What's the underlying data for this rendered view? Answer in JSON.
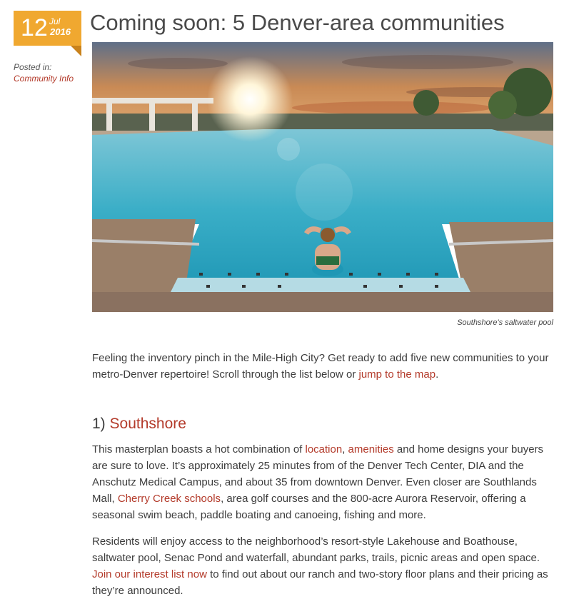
{
  "post": {
    "date": {
      "day": "12",
      "month": "Jul",
      "year": "2016"
    },
    "posted_in_label": "Posted in:",
    "category": "Community Info",
    "title": "Coming soon: 5 Denver-area communities"
  },
  "hero": {
    "caption": "Southshore's saltwater pool"
  },
  "intro": {
    "text_before": "Feeling the inventory pinch in the Mile-High City? Get ready to add five new communities to your metro-Denver repertoire! Scroll through the list below or ",
    "link_text": "jump to the map",
    "text_after": "."
  },
  "section1": {
    "number": "1) ",
    "heading_link": "Southshore",
    "p1": {
      "t1": "This masterplan boasts a hot combination of ",
      "l1": "location",
      "t2": ", ",
      "l2": "amenities",
      "t3": " and home designs your buyers are sure to love. It’s approximately 25 minutes from of the Denver Tech Center, DIA and the Anschutz Medical Campus, and about 35 from downtown Denver. Even closer are Southlands Mall, ",
      "l3": "Cherry Creek schools",
      "t4": ", area golf courses and the 800-acre Aurora Reservoir, offering a seasonal swim beach, paddle boating and canoeing, fishing and more."
    },
    "p2": {
      "t1": "Residents will enjoy access to the neighborhood’s resort-style Lakehouse and Boathouse, saltwater pool, Senac Pond and waterfall, abundant parks, trails, picnic areas and open space. ",
      "l1": "Join our interest list now",
      "t2": " to find out about our ranch and two-story floor plans and their pricing as they’re announced."
    }
  },
  "colors": {
    "accent": "#f0a830",
    "link": "#b33a2a",
    "pool": "#3fb6cc"
  }
}
